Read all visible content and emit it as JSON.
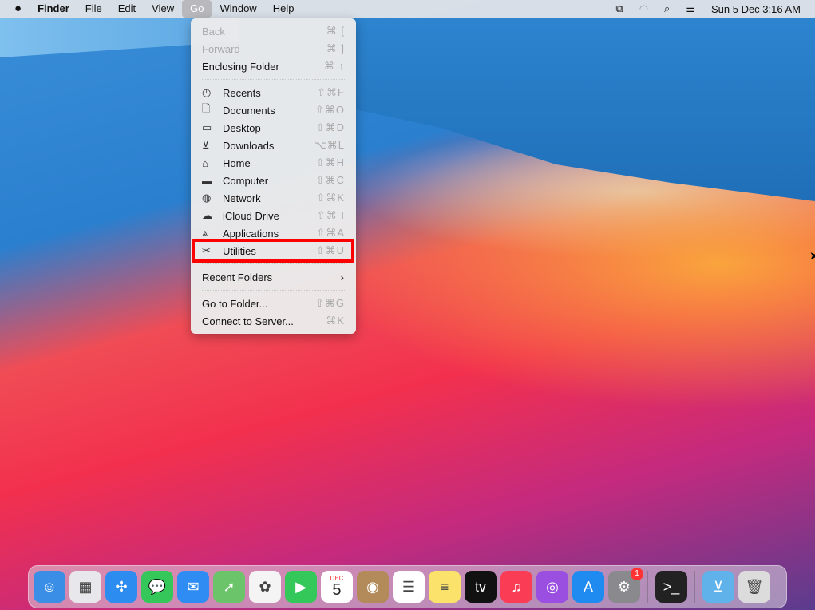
{
  "menubar": {
    "apple": "",
    "app": "Finder",
    "items": [
      "File",
      "Edit",
      "View",
      "Go",
      "Window",
      "Help"
    ],
    "active": "Go",
    "datetime": "Sun 5 Dec  3:16 AM"
  },
  "go_menu": {
    "top": [
      {
        "label": "Back",
        "shortcut": "⌘ [",
        "disabled": true
      },
      {
        "label": "Forward",
        "shortcut": "⌘ ]",
        "disabled": true
      },
      {
        "label": "Enclosing Folder",
        "shortcut": "⌘ ↑"
      }
    ],
    "places": [
      {
        "label": "Recents",
        "icon": "clock-icon",
        "glyph": "◷",
        "shortcut": "⇧⌘F"
      },
      {
        "label": "Documents",
        "icon": "document-icon",
        "glyph": "🗋",
        "shortcut": "⇧⌘O"
      },
      {
        "label": "Desktop",
        "icon": "desktop-icon",
        "glyph": "▭",
        "shortcut": "⇧⌘D"
      },
      {
        "label": "Downloads",
        "icon": "download-icon",
        "glyph": "⊻",
        "shortcut": "⌥⌘L"
      },
      {
        "label": "Home",
        "icon": "home-icon",
        "glyph": "⌂",
        "shortcut": "⇧⌘H"
      },
      {
        "label": "Computer",
        "icon": "computer-icon",
        "glyph": "▬",
        "shortcut": "⇧⌘C"
      },
      {
        "label": "Network",
        "icon": "globe-icon",
        "glyph": "◍",
        "shortcut": "⇧⌘K"
      },
      {
        "label": "iCloud Drive",
        "icon": "cloud-icon",
        "glyph": "☁",
        "shortcut": "⇧⌘ I"
      },
      {
        "label": "Applications",
        "icon": "applications-icon",
        "glyph": "⩓",
        "shortcut": "⇧⌘A"
      },
      {
        "label": "Utilities",
        "icon": "tools-icon",
        "glyph": "✂",
        "shortcut": "⇧⌘U"
      }
    ],
    "recent_folders": "Recent Folders",
    "bottom": [
      {
        "label": "Go to Folder...",
        "shortcut": "⇧⌘G"
      },
      {
        "label": "Connect to Server...",
        "shortcut": "⌘K"
      }
    ]
  },
  "dock": {
    "apps": [
      {
        "name": "Finder",
        "color": "#3a8ee6",
        "glyph": "☺"
      },
      {
        "name": "Launchpad",
        "color": "#e8e8ec",
        "glyph": "▦"
      },
      {
        "name": "Safari",
        "color": "#2c8cf0",
        "glyph": "✣"
      },
      {
        "name": "Messages",
        "color": "#35c759",
        "glyph": "💬"
      },
      {
        "name": "Mail",
        "color": "#2f8cf3",
        "glyph": "✉"
      },
      {
        "name": "Maps",
        "color": "#6cc46a",
        "glyph": "➚"
      },
      {
        "name": "Photos",
        "color": "#f4f4f4",
        "glyph": "✿"
      },
      {
        "name": "FaceTime",
        "color": "#34c759",
        "glyph": "▶"
      },
      {
        "name": "Calendar",
        "color": "#ffffff",
        "glyph": "5",
        "month": "DEC"
      },
      {
        "name": "Contacts",
        "color": "#b38b5a",
        "glyph": "◉"
      },
      {
        "name": "Reminders",
        "color": "#ffffff",
        "glyph": "☰"
      },
      {
        "name": "Notes",
        "color": "#fbe26b",
        "glyph": "≡"
      },
      {
        "name": "TV",
        "color": "#111111",
        "glyph": "tv"
      },
      {
        "name": "Music",
        "color": "#fa3c55",
        "glyph": "♫"
      },
      {
        "name": "Podcasts",
        "color": "#9b4fe0",
        "glyph": "◎"
      },
      {
        "name": "App Store",
        "color": "#1f8bf0",
        "glyph": "A"
      },
      {
        "name": "System Preferences",
        "color": "#8a8a8e",
        "glyph": "⚙",
        "badge": "1"
      }
    ],
    "extras": [
      {
        "name": "Terminal",
        "color": "#222",
        "glyph": ">_"
      }
    ],
    "stack": [
      {
        "name": "Downloads",
        "color": "#5fb2ea",
        "glyph": "⊻"
      },
      {
        "name": "Trash",
        "color": "#dcdcdc",
        "glyph": "🗑"
      }
    ]
  }
}
